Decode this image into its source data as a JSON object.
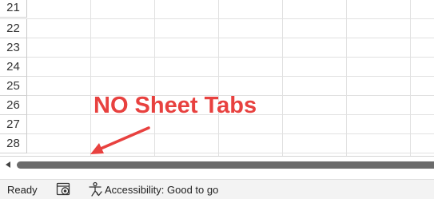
{
  "grid": {
    "rows": [
      "21",
      "22",
      "23",
      "24",
      "25",
      "26",
      "27",
      "28"
    ]
  },
  "annotation": {
    "text": "NO Sheet Tabs",
    "color": "#e8413f"
  },
  "statusbar": {
    "ready": "Ready",
    "accessibility": "Accessibility: Good to go"
  },
  "icons": {
    "scroll_left": "triangle-left-icon",
    "macro": "macro-record-icon",
    "accessibility": "accessibility-person-icon"
  }
}
